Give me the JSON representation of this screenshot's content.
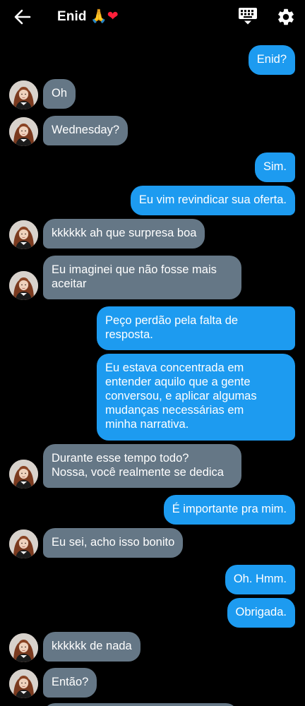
{
  "header": {
    "contact_name": "Enid",
    "emoji_pray": "🙏",
    "emoji_heart": "❤"
  },
  "messages": [
    {
      "side": "out",
      "text": "Enid?"
    },
    {
      "side": "in",
      "text": "Oh"
    },
    {
      "side": "in",
      "text": "Wednesday?"
    },
    {
      "side": "out",
      "text": "Sim."
    },
    {
      "side": "out",
      "text": "Eu vim revindicar sua oferta."
    },
    {
      "side": "in",
      "text": "kkkkkk ah que surpresa boa"
    },
    {
      "side": "in",
      "text": "Eu  imaginei que não fosse mais\naceitar"
    },
    {
      "side": "out",
      "text": "Peço perdão pela falta de\nresposta."
    },
    {
      "side": "out",
      "text": "Eu estava concentrada em\nentender aquilo que a gente\nconversou, e aplicar algumas\nmudanças necessárias em\nminha narrativa."
    },
    {
      "side": "in",
      "text": "Durante esse tempo todo?\nNossa, você realmente se dedica"
    },
    {
      "side": "out",
      "text": "É importante pra mim."
    },
    {
      "side": "in",
      "text": "Eu sei, acho isso bonito"
    },
    {
      "side": "out",
      "text": "Oh. Hmm."
    },
    {
      "side": "out",
      "text": "Obrigada."
    },
    {
      "side": "in",
      "text": "kkkkkk de nada"
    },
    {
      "side": "in",
      "text": "Então?"
    }
  ]
}
